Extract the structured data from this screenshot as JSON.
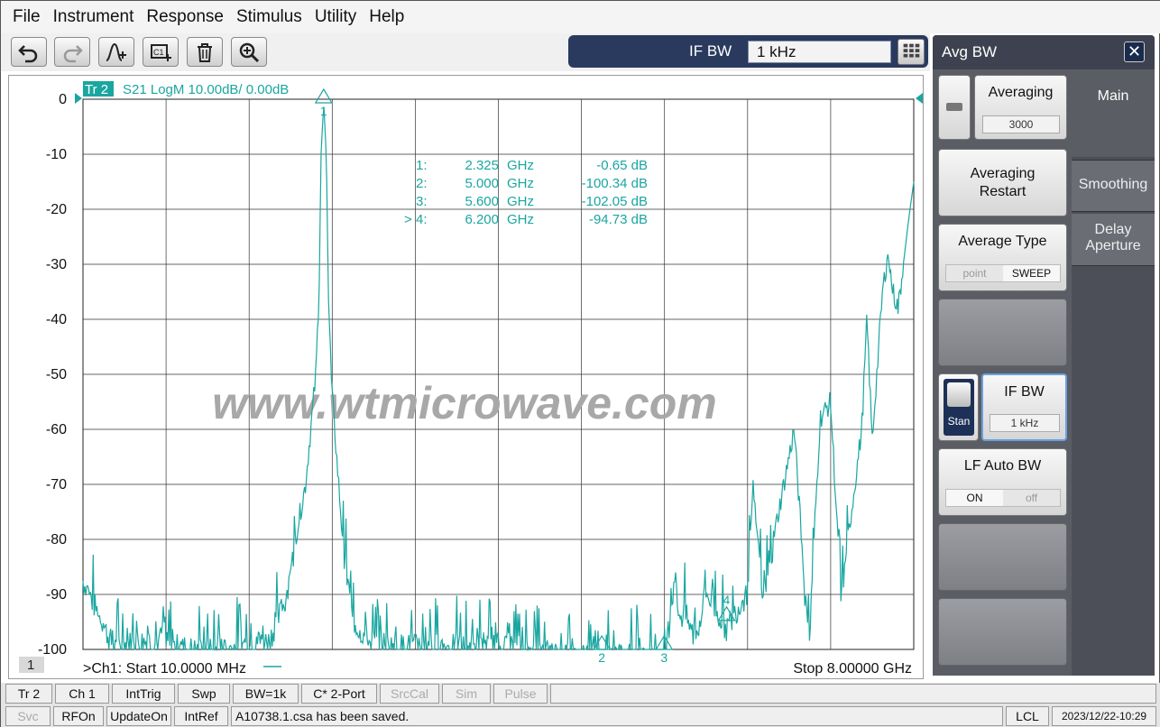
{
  "menu": [
    "File",
    "Instrument",
    "Response",
    "Stimulus",
    "Utility",
    "Help"
  ],
  "toolbar": {
    "buttons": [
      "undo-icon",
      "redo-icon",
      "add-trace-icon",
      "add-channel-icon",
      "delete-icon",
      "zoom-icon"
    ]
  },
  "entry": {
    "label": "IF BW",
    "value": "1 kHz"
  },
  "trace": {
    "tag": "Tr 2",
    "header": "S21 LogM 10.00dB/  0.00dB",
    "color": "#1aa6a0",
    "channel_badge": "1",
    "start_label": ">Ch1:  Start   10.0000 MHz",
    "stop_label": "Stop  8.00000 GHz"
  },
  "markers": [
    {
      "id": "1:",
      "freq": "2.325",
      "unit": "GHz",
      "value": "-0.65 dB",
      "active": false
    },
    {
      "id": "2:",
      "freq": "5.000",
      "unit": "GHz",
      "value": "-100.34 dB",
      "active": false
    },
    {
      "id": "3:",
      "freq": "5.600",
      "unit": "GHz",
      "value": "-102.05 dB",
      "active": false
    },
    {
      "id": "4:",
      "freq": "6.200",
      "unit": "GHz",
      "value": "-94.73 dB",
      "active": true
    }
  ],
  "active_marker_prefix": ">",
  "marker_labels": [
    "1",
    "2",
    "3",
    "4"
  ],
  "watermark": "www.wtmicrowave.com",
  "chart_data": {
    "type": "line",
    "title": "S21 LogM 10.00dB/  0.00dB",
    "xlabel": "",
    "ylabel": "",
    "xlim": [
      0.01,
      8.0
    ],
    "ylim": [
      -100,
      0
    ],
    "y_ticks": [
      "0",
      "-10",
      "-20",
      "-30",
      "-40",
      "-50",
      "-60",
      "-70",
      "-80",
      "-90",
      "-100"
    ],
    "grid": true,
    "series": [
      {
        "x": [
          0.01,
          0.3,
          0.6,
          0.9,
          1.2,
          1.5,
          1.8,
          1.95,
          2.05,
          2.15,
          2.2,
          2.25,
          2.28,
          2.3,
          2.325,
          2.35,
          2.37,
          2.4,
          2.45,
          2.5,
          2.6,
          2.75,
          3.0,
          3.5,
          4.0,
          4.5,
          5.0,
          5.3,
          5.6,
          5.7,
          5.75,
          5.8,
          5.9,
          6.0,
          6.2,
          6.4,
          6.45,
          6.55,
          6.7,
          6.85,
          6.95,
          7.0,
          7.1,
          7.2,
          7.3,
          7.4,
          7.5,
          7.55,
          7.6,
          7.7,
          7.75,
          7.8,
          7.85,
          7.9,
          7.95,
          8.0
        ],
        "y": [
          -86,
          -98,
          -97,
          -98,
          -99,
          -98,
          -97,
          -90,
          -80,
          -70,
          -60,
          -50,
          -35,
          -10,
          -0.65,
          -10,
          -35,
          -52,
          -65,
          -78,
          -93,
          -97,
          -98,
          -98,
          -98,
          -99,
          -100.34,
          -99,
          -102.05,
          -85,
          -93,
          -92,
          -97,
          -88,
          -94.73,
          -88,
          -70,
          -90,
          -75,
          -60,
          -88,
          -95,
          -58,
          -55,
          -90,
          -75,
          -60,
          -40,
          -62,
          -35,
          -28,
          -35,
          -38,
          -30,
          -22,
          -15
        ]
      }
    ]
  },
  "panel": {
    "title": "Avg BW",
    "close_symbol": "✕",
    "tabs": [
      "Main",
      "Smoothing",
      "Delay Aperture"
    ],
    "averaging_label": "Averaging",
    "averaging_value": "3000",
    "restart_label": "Averaging Restart",
    "avg_type_label": "Average Type",
    "avg_type_options": [
      "point",
      "SWEEP"
    ],
    "ifbw_label": "IF BW",
    "ifbw_value": "1 kHz",
    "stan_label": "Stan",
    "lf_auto_label": "LF Auto BW",
    "lf_auto_options": [
      "ON",
      "off"
    ]
  },
  "status1": [
    "Tr 2",
    "Ch 1",
    "IntTrig",
    "Swp",
    "BW=1k",
    "C* 2-Port",
    "SrcCal",
    "Sim",
    "Pulse"
  ],
  "status2": {
    "items": [
      "Svc",
      "RFOn",
      "UpdateOn",
      "IntRef"
    ],
    "message": "A10738.1.csa has been saved.",
    "lcl": "LCL",
    "datetime": "2023/12/22-10:29"
  }
}
